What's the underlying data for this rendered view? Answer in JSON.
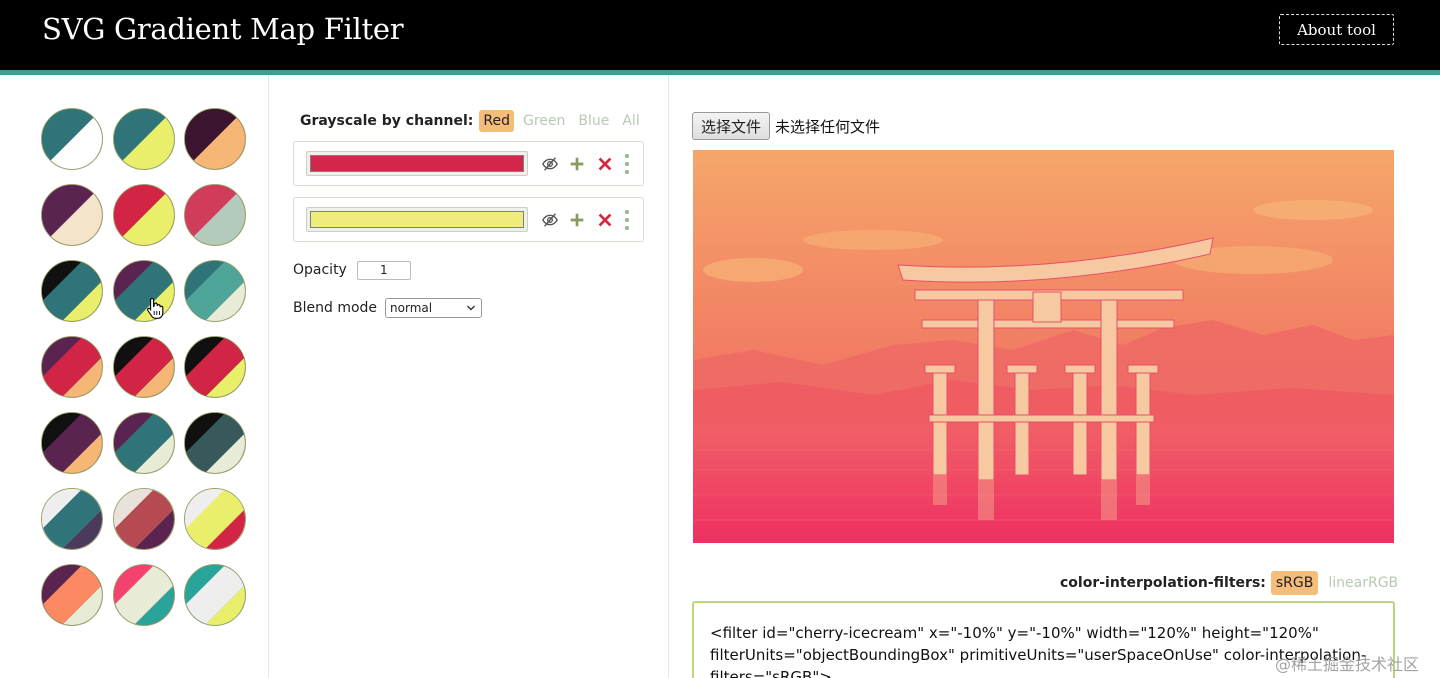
{
  "header": {
    "title": "SVG Gradient Map Filter",
    "about_label": "About tool"
  },
  "presets": [
    {
      "id": "p1",
      "colors": [
        "#2f7479",
        "#ffffff"
      ]
    },
    {
      "id": "p2",
      "colors": [
        "#2f7479",
        "#e9ee6b"
      ]
    },
    {
      "id": "p3",
      "colors": [
        "#3b1530",
        "#f6b676"
      ]
    },
    {
      "id": "p4",
      "colors": [
        "#5b2450",
        "#f4e4ca"
      ]
    },
    {
      "id": "p5",
      "colors": [
        "#d22546",
        "#e9ee6b"
      ]
    },
    {
      "id": "p6",
      "colors": [
        "#d03c5a",
        "#b3cbbd"
      ]
    },
    {
      "id": "p7",
      "colors": [
        "#101010",
        "#2f7479",
        "#e9ee6b"
      ]
    },
    {
      "id": "p8",
      "colors": [
        "#5b2450",
        "#2f7479",
        "#e9ee6b"
      ]
    },
    {
      "id": "p9",
      "colors": [
        "#2f7479",
        "#4fa599",
        "#e8ecd6"
      ]
    },
    {
      "id": "p10",
      "colors": [
        "#5b2450",
        "#d22546",
        "#f6b676"
      ]
    },
    {
      "id": "p11",
      "colors": [
        "#101010",
        "#d22546",
        "#f6b676"
      ]
    },
    {
      "id": "p12",
      "colors": [
        "#101010",
        "#d22546",
        "#e9ee6b"
      ]
    },
    {
      "id": "p13",
      "colors": [
        "#101010",
        "#5b2450",
        "#f6b676"
      ]
    },
    {
      "id": "p14",
      "colors": [
        "#5b2450",
        "#2f7479",
        "#e8ecd6"
      ]
    },
    {
      "id": "p15",
      "colors": [
        "#101010",
        "#37595c",
        "#e8ecd6"
      ]
    },
    {
      "id": "p16",
      "colors": [
        "#eeeeee",
        "#2f7479",
        "#4a3a5c"
      ]
    },
    {
      "id": "p17",
      "colors": [
        "#e8e2da",
        "#b64a52",
        "#5b2450"
      ]
    },
    {
      "id": "p18",
      "colors": [
        "#eeeeee",
        "#e9ee6b",
        "#d22546"
      ]
    },
    {
      "id": "p19",
      "colors": [
        "#5b2450",
        "#fb8a62",
        "#e8ecd6"
      ]
    },
    {
      "id": "p20",
      "colors": [
        "#f2426d",
        "#e8ecd6",
        "#2aa39a"
      ]
    },
    {
      "id": "p21",
      "colors": [
        "#2aa39a",
        "#eeeeee",
        "#e9ee6b"
      ]
    }
  ],
  "controls": {
    "channel_label": "Grayscale by channel:",
    "channels": [
      "Red",
      "Green",
      "Blue",
      "All"
    ],
    "active_channel": "Red",
    "stops": [
      {
        "color": "#d2274a",
        "hidden": true
      },
      {
        "color": "#f0ec7c",
        "hidden": true
      }
    ],
    "opacity_label": "Opacity",
    "opacity_value": "1",
    "blend_label": "Blend mode",
    "blend_value": "normal"
  },
  "file": {
    "button_label": "选择文件",
    "status": "未选择任何文件"
  },
  "preview": {
    "gradient_colors": [
      "#f5a66a",
      "#f04e5e",
      "#ee2f62"
    ]
  },
  "interpolation": {
    "label": "color-interpolation-filters:",
    "options": [
      "sRGB",
      "linearRGB"
    ],
    "active": "sRGB"
  },
  "code": {
    "text": "<filter id=\"cherry-icecream\" x=\"-10%\" y=\"-10%\" width=\"120%\" height=\"120%\" filterUnits=\"objectBoundingBox\" primitiveUnits=\"userSpaceOnUse\" color-interpolation-filters=\"sRGB\">"
  },
  "watermark": "@稀土掘金技术社区",
  "colors": {
    "accent": "#f6bd7a",
    "header_bg": "#000000",
    "header_bar": "#3d9e96",
    "inactive_text": "#b8c9b3",
    "code_border": "#b9d67a"
  }
}
